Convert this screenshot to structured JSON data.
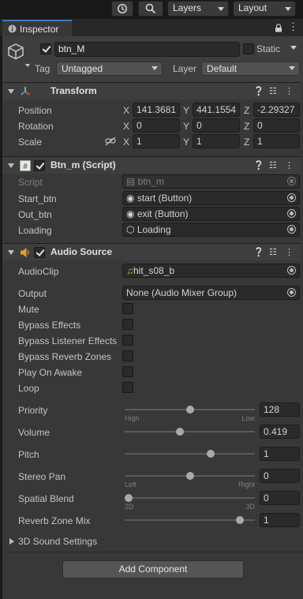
{
  "toolbar": {
    "layers_label": "Layers",
    "layout_label": "Layout"
  },
  "tab": {
    "label": "Inspector"
  },
  "object": {
    "name": "btn_M",
    "static_label": "Static",
    "tag_label": "Tag",
    "tag_value": "Untagged",
    "layer_label": "Layer",
    "layer_value": "Default"
  },
  "transform": {
    "title": "Transform",
    "position": {
      "label": "Position",
      "x": "141.3681",
      "y": "441.1554",
      "z": "-2.29327"
    },
    "rotation": {
      "label": "Rotation",
      "x": "0",
      "y": "0",
      "z": "0"
    },
    "scale": {
      "label": "Scale",
      "x": "1",
      "y": "1",
      "z": "1"
    }
  },
  "axes": {
    "x": "X",
    "y": "Y",
    "z": "Z"
  },
  "script_component": {
    "title": "Btn_m (Script)",
    "script_label": "Script",
    "script_value": "btn_m",
    "start_label": "Start_btn",
    "start_value": "start (Button)",
    "out_label": "Out_btn",
    "out_value": "exit (Button)",
    "loading_label": "Loading",
    "loading_value": "Loading"
  },
  "audio": {
    "title": "Audio Source",
    "clip_label": "AudioClip",
    "clip_value": "hit_s08_b",
    "output_label": "Output",
    "output_value": "None (Audio Mixer Group)",
    "checkboxes": [
      {
        "label": "Mute",
        "checked": false
      },
      {
        "label": "Bypass Effects",
        "checked": false
      },
      {
        "label": "Bypass Listener Effects",
        "checked": false
      },
      {
        "label": "Bypass Reverb Zones",
        "checked": false
      },
      {
        "label": "Play On Awake",
        "checked": false
      },
      {
        "label": "Loop",
        "checked": false
      }
    ],
    "sliders": [
      {
        "label": "Priority",
        "value": "128",
        "fraction": 0.5,
        "left": "High",
        "right": "Low"
      },
      {
        "label": "Volume",
        "value": "0.419",
        "fraction": 0.419,
        "left": "",
        "right": ""
      },
      {
        "label": "Pitch",
        "value": "1",
        "fraction": 0.67,
        "left": "",
        "right": ""
      },
      {
        "label": "Stereo Pan",
        "value": "0",
        "fraction": 0.5,
        "left": "Left",
        "right": "Right"
      },
      {
        "label": "Spatial Blend",
        "value": "0",
        "fraction": 0.0,
        "left": "2D",
        "right": "3D"
      },
      {
        "label": "Reverb Zone Mix",
        "value": "1",
        "fraction": 0.909,
        "left": "",
        "right": ""
      }
    ],
    "sound3d_label": "3D Sound Settings"
  },
  "add_component_label": "Add Component",
  "colors": {
    "background": "#383838",
    "header": "#3e3e3e",
    "field": "#2a2a2a",
    "accent_check": "#e4e4e4"
  }
}
